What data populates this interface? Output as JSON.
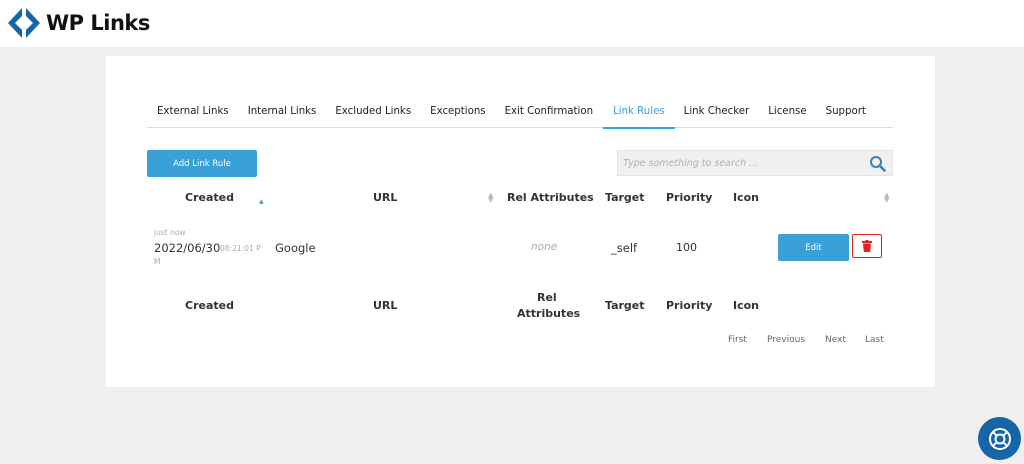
{
  "brand": {
    "name": "WP Links",
    "accent": "#3aa0d8",
    "logo_color": "#1565a8"
  },
  "tabs": [
    {
      "label": "External Links"
    },
    {
      "label": "Internal Links"
    },
    {
      "label": "Excluded Links"
    },
    {
      "label": "Exceptions"
    },
    {
      "label": "Exit Confirmation"
    },
    {
      "label": "Link Rules",
      "active": true
    },
    {
      "label": "Link Checker"
    },
    {
      "label": "License"
    },
    {
      "label": "Support"
    }
  ],
  "toolbar": {
    "add_label": "Add Link Rule",
    "search_placeholder": "Type something to search ..."
  },
  "table": {
    "headers": {
      "created": "Created",
      "url": "URL",
      "rel": "Rel Attributes",
      "target": "Target",
      "priority": "Priority",
      "icon": "Icon"
    },
    "footer_headers": {
      "created": "Created",
      "url": "URL",
      "rel_line1": "Rel",
      "rel_line2": "Attributes",
      "target": "Target",
      "priority": "Priority",
      "icon": "Icon"
    },
    "rows": [
      {
        "relative_time": "just now",
        "date": "2022/06/30",
        "time_part1": "08:21:01 P",
        "time_part2": "M",
        "url": "Google",
        "rel": "none",
        "target": "_self",
        "priority": "100",
        "edit_label": "Edit"
      }
    ]
  },
  "pagination": {
    "first": "First",
    "previous": "Previous",
    "next": "Next",
    "last": "Last"
  },
  "icons": {
    "search": "search-icon",
    "delete": "trash-icon",
    "help": "lifebuoy-icon",
    "sort": "sort-icon"
  }
}
